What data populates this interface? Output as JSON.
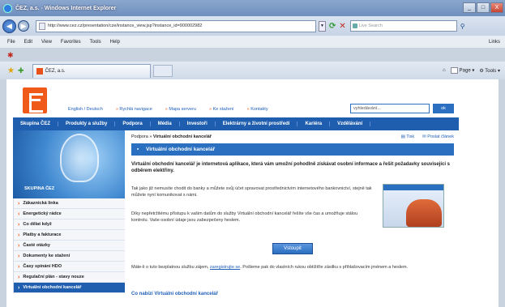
{
  "window": {
    "title": "ČEZ, a.s. - Windows Internet Explorer",
    "min": "_",
    "max": "□",
    "close": "X"
  },
  "address": {
    "url": "http://www.cez.cz/presentation/cze/instance_view.jsp?instance_id=900002982",
    "search_placeholder": "Live Search"
  },
  "menu": {
    "items": [
      "File",
      "Edit",
      "View",
      "Favorites",
      "Tools",
      "Help"
    ],
    "links": "Links"
  },
  "tab": {
    "label": "ČEZ, a.s."
  },
  "commands": {
    "page": "Page",
    "tools": "Tools"
  },
  "site": {
    "toplinks": [
      "English / Deutsch",
      "Rychlá navigace",
      "Mapa serveru",
      "Ke stažení",
      "Kontakty"
    ],
    "search_value": "vyhledávání...",
    "search_button": "ok",
    "nav": [
      "Skupina ČEZ",
      "Produkty a služby",
      "Podpora",
      "Média",
      "Investoři",
      "Elektrárny a životní prostředí",
      "Kariéra",
      "Vzdělávání"
    ],
    "hero_label": "SKUPINA ČEZ",
    "sidebar": [
      "Zákaznická linka",
      "Energetický rádce",
      "Co dělat když",
      "Platby a fakturace",
      "Časté otázky",
      "Dokumenty ke stažení",
      "Časy spínání HDO",
      "Regulační plán - stavy nouze",
      "Virtuální obchodní kancelář"
    ],
    "breadcrumb_prefix": "Podpora »",
    "breadcrumb_current": "Virtuální obchodní kancelář",
    "tools": [
      "Tisk",
      "Poslat článek"
    ],
    "page_title": "Virtuální obchodní kancelář",
    "intro": "Virtuální obchodní kancelář je internetová aplikace, která vám umožní pohodlně získávat osobní informace a řešit požadavky související s odběrem elektřiny.",
    "para1": "Tak jako již nemusíte chodit do banky a můžete svůj účet spravovat prostřednictvím internetového bankovnictví, stejně tak můžete nyní komunikovat s námi.",
    "para2": "Díky nepřetržitému přístupu k vašim datům do služby Virtuální obchodní kancelář řešíte vše čas a umožňuje stálou kontrolu. Vaše osobní údaje jsou zabezpečeny heslem.",
    "enter_button": "Vstoupit",
    "para3_a": "Máte-li o tuto bezplatnou službu zájem,",
    "para3_link": "zaregistrujte se",
    "para3_b": ". Pošleme pak do vlastních rukou obtížiťte zásilku s přihlašovacím jménem a heslem.",
    "subheading": "Co nabízí Virtuální obchodní kancelář"
  }
}
